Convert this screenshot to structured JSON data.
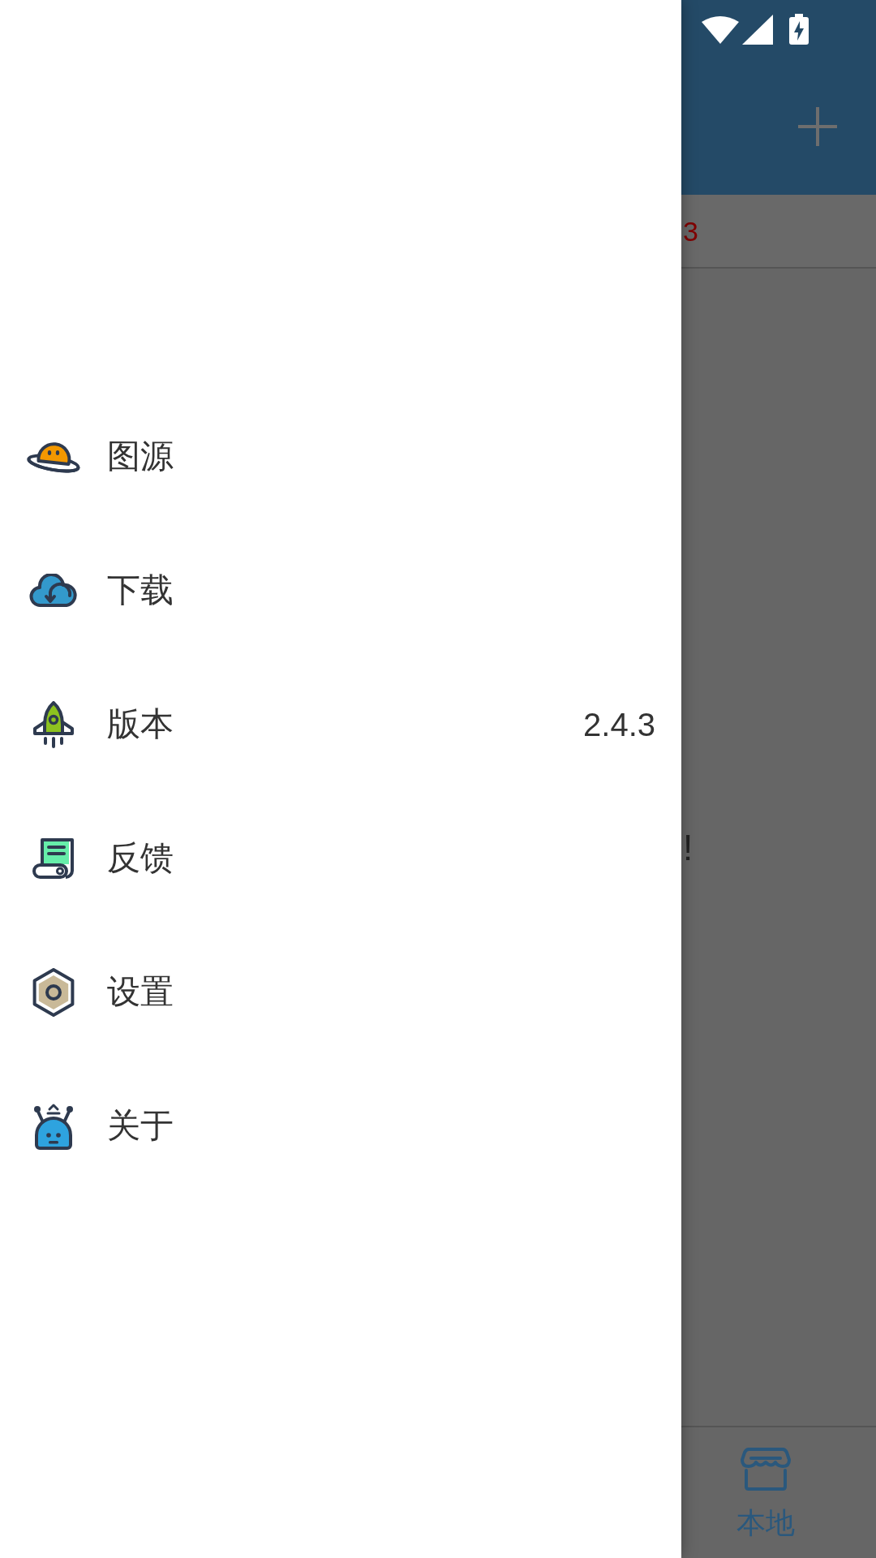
{
  "drawer": {
    "items": [
      {
        "label": "图源"
      },
      {
        "label": "下载"
      },
      {
        "label": "版本",
        "value": "2.4.3"
      },
      {
        "label": "反馈"
      },
      {
        "label": "设置"
      },
      {
        "label": "关于"
      }
    ]
  },
  "main": {
    "tab_strip": {
      "text": "3"
    },
    "content": {
      "text": "!"
    },
    "bottom_nav": {
      "items": [
        {
          "label": "本地",
          "selected": true
        }
      ]
    }
  }
}
